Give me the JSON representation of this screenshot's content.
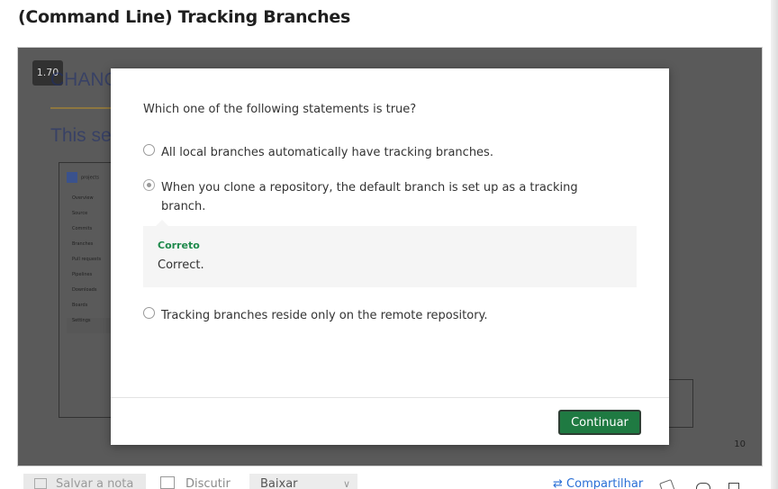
{
  "page_title": "(Command Line) Tracking Branches",
  "player": {
    "speed": "1.70",
    "slide_heading": "CHANG",
    "slide_subheading": "This se",
    "mini_app": {
      "project": "projects",
      "items": [
        "Overview",
        "Source",
        "Commits",
        "Branches",
        "Pull requests",
        "Pipelines",
        "Downloads",
        "Boards",
        "Settings"
      ]
    },
    "slide_number": "10"
  },
  "quiz": {
    "question": "Which one of the following statements is true?",
    "options": [
      {
        "label": "All local branches automatically have tracking branches.",
        "selected": false
      },
      {
        "label": "When you clone a repository, the default branch is set up as a tracking branch.",
        "selected": true
      },
      {
        "label": "Tracking branches reside only on the remote repository.",
        "selected": false
      }
    ],
    "feedback": {
      "title": "Correto",
      "text": "Correct."
    },
    "continue_label": "Continuar"
  },
  "toolbar": {
    "save_note": "Salvar a nota",
    "discuss": "Discutir",
    "download": "Baixar",
    "share": "Compartilhar"
  },
  "colors": {
    "accent_green": "#1f7a42",
    "feedback_green": "#1f8a4c",
    "link_blue": "#2a6fd6"
  }
}
